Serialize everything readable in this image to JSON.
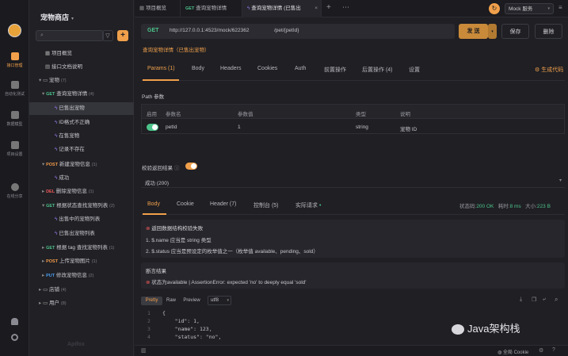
{
  "rail": {
    "items": [
      {
        "label": "接口管理",
        "icon": "api-icon"
      },
      {
        "label": "自动化测试",
        "icon": "auto-test-icon"
      },
      {
        "label": "数据模型",
        "icon": "data-model-icon"
      },
      {
        "label": "项目设置",
        "icon": "settings-icon"
      },
      {
        "label": "在线分享",
        "icon": "share-icon"
      }
    ]
  },
  "sidebar": {
    "project_name": "宠物商店",
    "search_placeholder": "",
    "tree": [
      {
        "label": "项目概览"
      },
      {
        "label": "接口文档说明"
      },
      {
        "label": "宠物",
        "count": "(7)"
      },
      {
        "method": "GET",
        "label": "查询宠物详情",
        "count": "(4)"
      },
      {
        "label": "已售出宠物"
      },
      {
        "label": "ID格式不正确"
      },
      {
        "label": "在售宠物"
      },
      {
        "label": "记录不存在"
      },
      {
        "method": "POST",
        "label": "新建宠物信息",
        "count": "(1)"
      },
      {
        "label": "成功"
      },
      {
        "method": "DEL",
        "label": "删除宠物信息",
        "count": "(1)"
      },
      {
        "method": "GET",
        "label": "根据状态查找宠物列表",
        "count": "(2)"
      },
      {
        "label": "出售中的宠物列表"
      },
      {
        "label": "已售出宠物列表"
      },
      {
        "method": "GET",
        "label": "根据 tag 查找宠物列表",
        "count": "(1)"
      },
      {
        "method": "POST",
        "label": "上传宠物图片",
        "count": "(1)"
      },
      {
        "method": "PUT",
        "label": "修改宠物信息",
        "count": "(2)"
      },
      {
        "label": "店铺",
        "count": "(4)"
      },
      {
        "label": "用户",
        "count": "(8)"
      }
    ],
    "footer_logo": "Apifox"
  },
  "tabs": [
    {
      "label": "项目概览"
    },
    {
      "method": "GET",
      "label": "查询宠物详情"
    },
    {
      "label": "查询宠物详情 (已售出"
    }
  ],
  "env": {
    "label": "Mock 服务"
  },
  "request": {
    "method": "GET",
    "base_url": "http://127.0.0.1:4523/mock/622362",
    "path": "/pet/{petId}",
    "send_label": "发 送",
    "save_label": "保存",
    "delete_label": "删除",
    "case_name": "查询宠物详情（已售出宠物）"
  },
  "req_tabs": [
    {
      "label": "Params (1)"
    },
    {
      "label": "Body"
    },
    {
      "label": "Headers"
    },
    {
      "label": "Cookies"
    },
    {
      "label": "Auth"
    },
    {
      "label": "前置操作"
    },
    {
      "label": "后置操作 (4)"
    },
    {
      "label": "设置"
    }
  ],
  "gen_code": "生成代码",
  "path_params": {
    "title": "Path 参数",
    "headers": [
      "启用",
      "参数名",
      "参数值",
      "类型",
      "说明"
    ],
    "rows": [
      {
        "name": "petId",
        "value": "1",
        "type": "string",
        "desc": "宠物 ID"
      }
    ]
  },
  "validate": {
    "label": "校验返回结果",
    "select": "成功 (200)"
  },
  "resp_tabs": [
    {
      "label": "Body"
    },
    {
      "label": "Cookie"
    },
    {
      "label": "Header (7)"
    },
    {
      "label": "控制台 (5)"
    },
    {
      "label": "实际请求"
    }
  ],
  "resp_status": {
    "status_label": "状态码:",
    "status_value": "200 OK",
    "time_label": "耗时:",
    "time_value": "8 ms",
    "size_label": "大小:",
    "size_value": "223 B"
  },
  "validation_error": {
    "title": "返回数据结构校验失败",
    "items": [
      "1. $.name 应当是 string 类型",
      "2. $.status 应当是预设定的枚举值之一（枚举值 available、pending、sold）"
    ]
  },
  "assertion": {
    "title": "断言结果",
    "item": "状态为available | AssertionError: expected 'no' to deeply equal 'sold'"
  },
  "body_toolbar": {
    "modes": [
      "Pretty",
      "Raw",
      "Preview"
    ],
    "encoding": "utf8"
  },
  "code_lines": [
    {
      "num": "1",
      "text": "{"
    },
    {
      "num": "2",
      "text": "    \"id\": 1,"
    },
    {
      "num": "3",
      "text": "    \"name\": 123,"
    },
    {
      "num": "4",
      "text": "    \"status\": \"no\","
    }
  ],
  "cookie_label": "全局 Cookie",
  "watermark": "Java架构栈",
  "colors": {
    "accent": "#f0a04b",
    "get": "#4cc38a",
    "post": "#f09a4a",
    "del": "#ef5a5a",
    "put": "#4a9df0"
  }
}
